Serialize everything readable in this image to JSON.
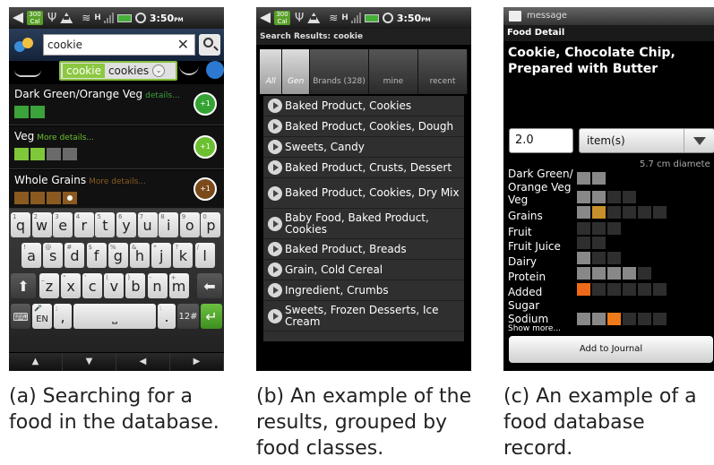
{
  "status_bar": {
    "cal_badge": "300",
    "cal_sub": "Cal",
    "network": "H",
    "time": "3:50",
    "ampm": "PM"
  },
  "phone_a": {
    "search_value": "cookie",
    "clear_glyph": "✕",
    "suggestions": [
      "cookie",
      "cookies",
      "⌄"
    ],
    "groups": [
      {
        "name": "Dark Green/Orange Veg",
        "details": "details...",
        "badge": "+1",
        "accent": "#34a334",
        "squares": [
          "#3aa33a",
          "#3aa33a"
        ]
      },
      {
        "name": "Veg",
        "details": "More details...",
        "badge": "+1",
        "accent": "#6cc030",
        "squares": [
          "#7ec83a",
          "#7ec83a",
          "#6a6a6a",
          "#6a6a6a"
        ]
      },
      {
        "name": "Whole Grains",
        "details": "More details...",
        "badge": "+1",
        "accent": "#7a4a1a",
        "squares": [
          "#8a5a20",
          "#8a5a20",
          "#8a5a20",
          "#ffffff"
        ]
      }
    ],
    "keyboard": {
      "row1": [
        [
          "1",
          "q"
        ],
        [
          "2",
          "w"
        ],
        [
          "3",
          "e"
        ],
        [
          "4",
          "r"
        ],
        [
          "5",
          "t"
        ],
        [
          "6",
          "y"
        ],
        [
          "7",
          "u"
        ],
        [
          "8",
          "i"
        ],
        [
          "9",
          "o"
        ],
        [
          "0",
          "p"
        ]
      ],
      "row2": [
        [
          "!",
          "a"
        ],
        [
          "@",
          "s"
        ],
        [
          "#",
          "d"
        ],
        [
          "$",
          "f"
        ],
        [
          "%",
          "g"
        ],
        [
          "&",
          "h"
        ],
        [
          "*",
          "j"
        ],
        [
          "?",
          "k"
        ],
        [
          "/",
          "l"
        ]
      ],
      "row3": [
        [
          "_",
          "z"
        ],
        [
          "\"",
          "x"
        ],
        [
          "'",
          "c"
        ],
        [
          "(",
          "v"
        ],
        [
          ")",
          "b"
        ],
        [
          "-",
          "n"
        ],
        [
          "+",
          "m"
        ]
      ],
      "shift": "⬆",
      "backspace": "⬅",
      "lang": "EN",
      "mic": "🎤",
      "comma": ",",
      "semicolon": ";",
      "space": "⎵",
      "colon": ":",
      "period": ".",
      "sym": "12#",
      "enter": "↵",
      "keyboard_icon": "⌨"
    },
    "nav": [
      "▲",
      "▼",
      "◀",
      "▶"
    ]
  },
  "phone_b": {
    "title": "Search Results: cookie",
    "tabs": [
      "All",
      "Gen",
      "Brands (328)",
      "mine",
      "recent"
    ],
    "results": [
      "Baked Product, Cookies",
      "Baked Product, Cookies, Dough",
      "Sweets, Candy",
      "Baked Product, Crusts, Dessert",
      "Baked Product, Cookies, Dry Mix",
      "Baby Food, Baked Product, Cookies",
      "Baked Product, Breads",
      "Grain, Cold Cereal",
      "Ingredient, Crumbs",
      "Sweets, Frozen Desserts, Ice Cream"
    ]
  },
  "phone_c": {
    "status_title": "message",
    "header": "Food Detail",
    "food_name": "Cookie, Chocolate Chip, Prepared with Butter",
    "amount": "2.0",
    "unit": "item(s)",
    "diameter": "5.7 cm diamete",
    "nutrients": [
      {
        "name": "Dark Green/ Orange Veg",
        "cells": [
          "#888",
          "#888"
        ]
      },
      {
        "name": "Veg",
        "cells": [
          "#888",
          "#888",
          "#2e2e2e",
          "#2e2e2e"
        ]
      },
      {
        "name": "Grains",
        "cells": [
          "#888",
          "#c8902a",
          "#2e2e2e",
          "#2e2e2e",
          "#2e2e2e",
          "#2e2e2e"
        ]
      },
      {
        "name": "Fruit",
        "cells": [
          "#2e2e2e",
          "#2e2e2e",
          "#2e2e2e"
        ]
      },
      {
        "name": "Fruit Juice",
        "cells": [
          "#2e2e2e",
          "#2e2e2e"
        ]
      },
      {
        "name": "Dairy",
        "cells": [
          "#888",
          "#2e2e2e",
          "#2e2e2e"
        ]
      },
      {
        "name": "Protein",
        "cells": [
          "#888",
          "#888",
          "#888",
          "#888",
          "#2e2e2e"
        ]
      },
      {
        "name": "Added Sugar",
        "cells": [
          "#ee6a1a",
          "#2e2e2e",
          "#2e2e2e",
          "#2e2e2e",
          "#2e2e2e",
          "#2e2e2e"
        ]
      },
      {
        "name": "Sodium",
        "cells": [
          "#888",
          "#888",
          "#ee7a1a",
          "#2e2e2e",
          "#2e2e2e",
          "#2e2e2e"
        ]
      }
    ],
    "show_more": "Show more...",
    "add_button": "Add to Journal"
  },
  "captions": {
    "a": "(a) Searching for a food in the database.",
    "b": "(b) An example of the results, grouped by food classes.",
    "c": "(c) An example of a food database record."
  }
}
